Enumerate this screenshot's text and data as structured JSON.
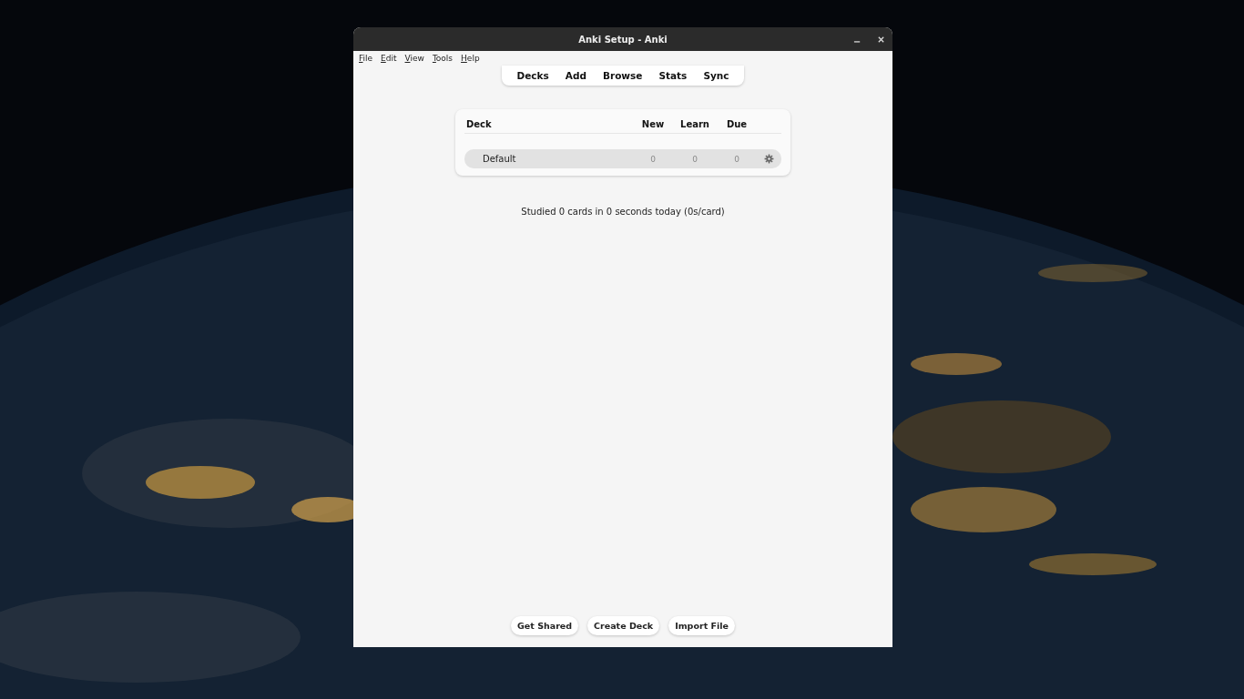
{
  "desktop": {
    "kind": "picture"
  },
  "window": {
    "title": "Anki Setup - Anki"
  },
  "menu": [
    "File",
    "Edit",
    "View",
    "Tools",
    "Help"
  ],
  "toolbar": [
    "Decks",
    "Add",
    "Browse",
    "Stats",
    "Sync"
  ],
  "deck_table": {
    "columns": [
      "Deck",
      "New",
      "Learn",
      "Due"
    ],
    "rows": [
      {
        "name": "Default",
        "new": "0",
        "learn": "0",
        "due": "0",
        "selected": true
      }
    ]
  },
  "summary": "Studied 0 cards in 0 seconds today (0s/card)",
  "buttons": [
    "Get Shared",
    "Create Deck",
    "Import File"
  ]
}
